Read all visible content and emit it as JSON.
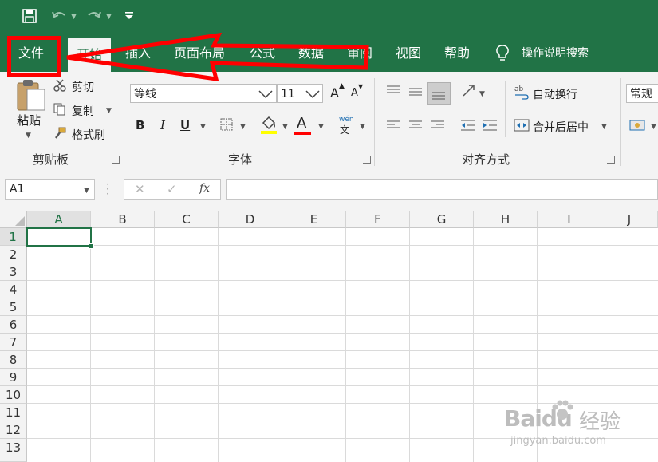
{
  "qat": {
    "save_icon": "save-icon",
    "undo_icon": "undo-icon",
    "redo_icon": "redo-icon",
    "customize_icon": "customize-qat-icon"
  },
  "tabs": [
    {
      "label": "文件"
    },
    {
      "label": "开始"
    },
    {
      "label": "插入"
    },
    {
      "label": "页面布局"
    },
    {
      "label": "公式"
    },
    {
      "label": "数据"
    },
    {
      "label": "审阅"
    },
    {
      "label": "视图"
    },
    {
      "label": "帮助"
    }
  ],
  "tell_me": {
    "label": "操作说明搜索",
    "icon": "lightbulb-icon"
  },
  "clipboard": {
    "paste": "粘贴",
    "cut": "剪切",
    "copy": "复制",
    "format_painter": "格式刷",
    "group": "剪贴板"
  },
  "font": {
    "name": "等线",
    "size": "11",
    "grow": "A",
    "shrink": "A",
    "bold": "B",
    "italic": "I",
    "underline": "U",
    "font_color": "A",
    "phonetic_top": "wén",
    "phonetic_bottom": "文",
    "group": "字体"
  },
  "alignment": {
    "wrap": "自动换行",
    "merge": "合并后居中",
    "group": "对齐方式"
  },
  "number": {
    "format": "常规"
  },
  "formula_bar": {
    "name_box": "A1",
    "cancel": "✕",
    "enter": "✓",
    "fx": "fx",
    "value": ""
  },
  "columns": [
    "A",
    "B",
    "C",
    "D",
    "E",
    "F",
    "G",
    "H",
    "I",
    "J"
  ],
  "rows": [
    "1",
    "2",
    "3",
    "4",
    "5",
    "6",
    "7",
    "8",
    "9",
    "10",
    "11",
    "12",
    "13"
  ],
  "colors": {
    "excel_green": "#217346",
    "highlight": "#ff0000",
    "fill_yellow": "#ffff00",
    "font_red": "#ff0000"
  },
  "watermark": {
    "brand": "Baidu",
    "sub": "经验",
    "url": "jingyan.baidu.com"
  }
}
